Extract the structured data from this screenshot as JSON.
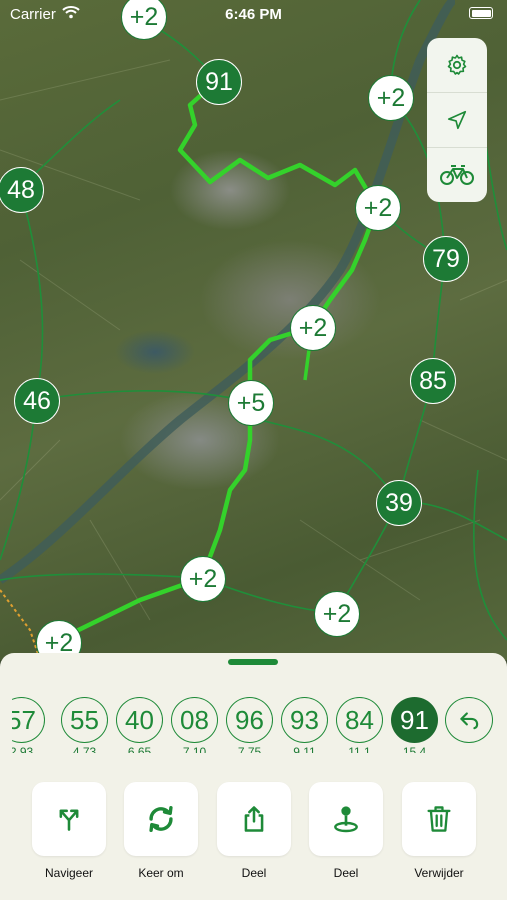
{
  "status_bar": {
    "carrier": "Carrier",
    "time": "6:46 PM"
  },
  "map": {
    "nodes": [
      {
        "label": "+2",
        "style": "white"
      },
      {
        "label": "91",
        "style": "green"
      },
      {
        "label": "+2",
        "style": "white"
      },
      {
        "label": "48",
        "style": "green"
      },
      {
        "label": "+2",
        "style": "white"
      },
      {
        "label": "79",
        "style": "green"
      },
      {
        "label": "+2",
        "style": "white"
      },
      {
        "label": "46",
        "style": "green"
      },
      {
        "label": "85",
        "style": "green"
      },
      {
        "label": "+5",
        "style": "white"
      },
      {
        "label": "39",
        "style": "green"
      },
      {
        "label": "+2",
        "style": "white"
      },
      {
        "label": "+2",
        "style": "white"
      },
      {
        "label": "+2",
        "style": "white"
      }
    ],
    "controls": [
      "gear-icon",
      "location-arrow-icon",
      "bicycle-icon"
    ]
  },
  "route_sheet": {
    "nodes": [
      {
        "number": "57",
        "distance": "2.93"
      },
      {
        "number": "55",
        "distance": "4.73"
      },
      {
        "number": "40",
        "distance": "6.65"
      },
      {
        "number": "08",
        "distance": "7.10"
      },
      {
        "number": "96",
        "distance": "7.75"
      },
      {
        "number": "93",
        "distance": "9.11"
      },
      {
        "number": "84",
        "distance": "11.1"
      },
      {
        "number": "91",
        "distance": "15.4",
        "active": true
      }
    ],
    "actions": [
      {
        "label": "Navigeer",
        "icon": "split-arrow-icon"
      },
      {
        "label": "Keer om",
        "icon": "reverse-icon"
      },
      {
        "label": "Deel",
        "icon": "share-icon"
      },
      {
        "label": "Deel",
        "icon": "map-pin-icon"
      },
      {
        "label": "Verwijder",
        "icon": "trash-icon"
      }
    ]
  },
  "colors": {
    "accent": "#1e8a38",
    "route": "#34d22b",
    "sheet_bg": "#f2f2e8"
  }
}
